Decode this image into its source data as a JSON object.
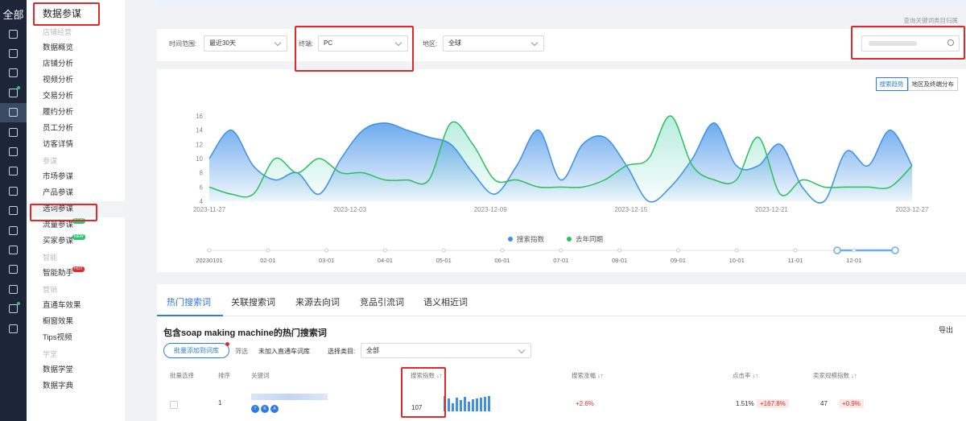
{
  "sidebar_icons": {
    "all_label": "全部",
    "icons": [
      "home-icon",
      "store-icon",
      "calendar-icon",
      "video-icon",
      "chart-bar-icon",
      "broadcast-icon",
      "ticket-icon",
      "message-icon",
      "users-icon",
      "clipboard-icon",
      "globe-icon",
      "bag-icon",
      "truck-icon",
      "shield-icon",
      "plant-icon",
      "briefcase-icon"
    ]
  },
  "menu": {
    "title": "数据参谋",
    "groups": [
      {
        "name": "店铺经营",
        "items": [
          "数据概览",
          "店铺分析",
          "视频分析",
          "交易分析",
          "履约分析",
          "员工分析",
          "访客详情"
        ]
      },
      {
        "name": "参谋",
        "items": [
          "市场参谋",
          "产品参谋",
          "选词参谋",
          "流量参谋",
          "买家参谋"
        ]
      },
      {
        "name": "智能",
        "items": [
          "智能助手"
        ]
      },
      {
        "name": "营销",
        "items": [
          "直通车效果",
          "橱窗效果",
          "Tips视频"
        ]
      },
      {
        "name": "学堂",
        "items": [
          "数据学堂",
          "数据字典"
        ]
      }
    ],
    "selected": "选词参谋",
    "badges": {
      "new": "NEW",
      "hot": "HOT"
    }
  },
  "header": {
    "hint": "查询关键词类目归属"
  },
  "filters": {
    "time_label": "时间范围:",
    "time_value": "最近30天",
    "terminal_label": "终端:",
    "terminal_value": "PC",
    "region_label": "地区:",
    "region_value": "全球"
  },
  "chart_tabs": [
    "搜索趋势",
    "地区及终端分布"
  ],
  "chart_data": {
    "type": "area",
    "x_ticks": [
      "2023-11-27",
      "2023-12-03",
      "2023-12-09",
      "2023-12-15",
      "2023-12-21",
      "2023-12-27"
    ],
    "ylim": [
      4,
      16
    ],
    "y_ticks": [
      4,
      6,
      8,
      10,
      12,
      14,
      16
    ],
    "series": [
      {
        "name": "搜索指数",
        "color": "#3d8fe8",
        "values": [
          10,
          14,
          9,
          7,
          8,
          5,
          10,
          14,
          15,
          14,
          13,
          12,
          8,
          5,
          9,
          14,
          7,
          12,
          13,
          9,
          4,
          6,
          10,
          15,
          9,
          9,
          12,
          6,
          4,
          11,
          9,
          14,
          9
        ]
      },
      {
        "name": "去年同期",
        "color": "#2bbf5a",
        "values": [
          6,
          5,
          5,
          10,
          8,
          10,
          8,
          8,
          7,
          7,
          7,
          15,
          12,
          7,
          7,
          6,
          6,
          6,
          7,
          9,
          10,
          16,
          9,
          7,
          7,
          13,
          5,
          7,
          6,
          6,
          6,
          6,
          9
        ]
      }
    ],
    "range_labels": [
      "20230101",
      "02-01",
      "03-01",
      "04-01",
      "05-01",
      "06-01",
      "07-01",
      "08-01",
      "09-01",
      "10-01",
      "11-01",
      "12-01"
    ]
  },
  "list": {
    "tabs": [
      "热门搜索词",
      "关联搜索词",
      "来源去向词",
      "竞品引流词",
      "语义相近词"
    ],
    "title": "包含soap making machine的热门搜索词",
    "export_label": "导出",
    "add_button": "批量添加到词库",
    "filter_label": "筛选",
    "filter_value": "未加入直通车词库",
    "category_label": "选择类目:",
    "category_value": "全部",
    "headers": [
      "批量选择",
      "排序",
      "关键词",
      "搜索指数",
      "搜索涨幅",
      "点击率",
      "卖家规模指数"
    ],
    "row": {
      "rank": "1",
      "search_index": "107",
      "growth": "+2.6%",
      "ctr": "1.51%",
      "ctr_change": "+167.8%",
      "sellers": "47",
      "sellers_change": "+0.9%",
      "tags": [
        "T",
        "K",
        "A"
      ]
    }
  }
}
